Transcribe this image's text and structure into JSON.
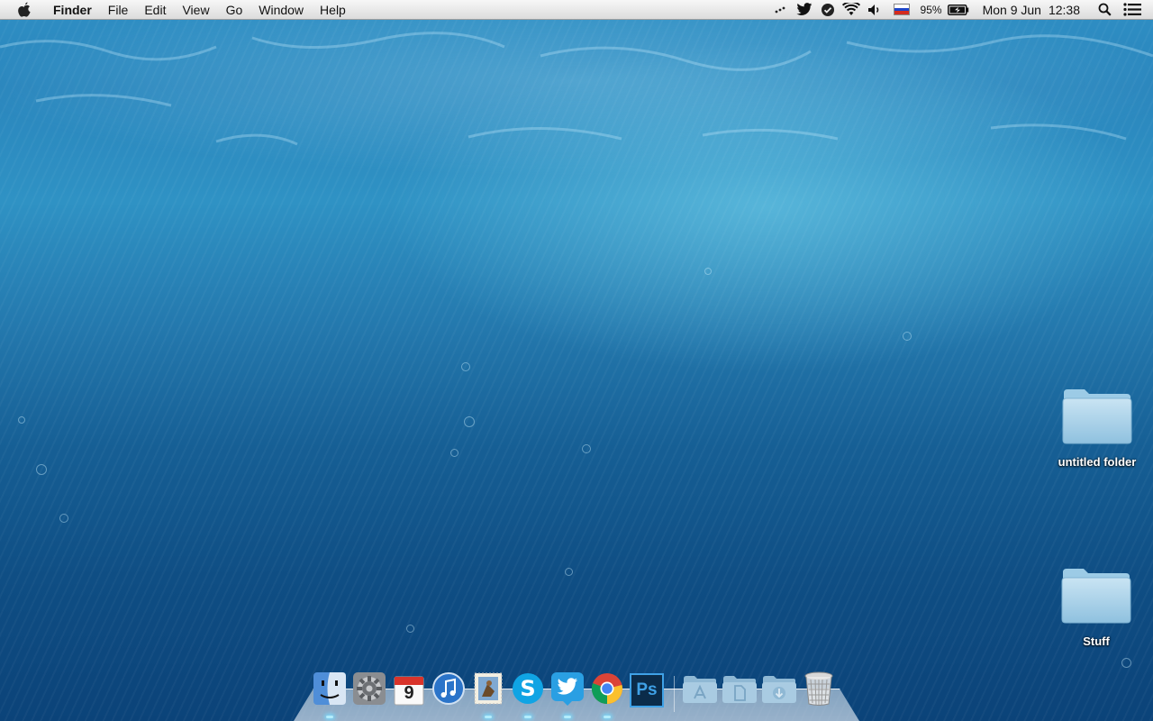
{
  "menubar": {
    "app_name": "Finder",
    "menus": [
      "File",
      "Edit",
      "View",
      "Go",
      "Window",
      "Help"
    ],
    "status": {
      "battery_percent": "95%",
      "date": "Mon 9 Jun",
      "time": "12:38"
    }
  },
  "desktop": {
    "items": [
      {
        "label": "untitled folder",
        "icon": "folder-icon"
      },
      {
        "label": "Stuff",
        "icon": "folder-icon"
      }
    ]
  },
  "dock": {
    "apps": [
      {
        "name": "Finder",
        "icon": "finder-icon",
        "running": true
      },
      {
        "name": "System Preferences",
        "icon": "gear-icon",
        "running": false
      },
      {
        "name": "Calendar",
        "icon": "calendar-icon",
        "running": false
      },
      {
        "name": "iTunes",
        "icon": "itunes-icon",
        "running": false
      },
      {
        "name": "Mail",
        "icon": "mail-stamp-icon",
        "running": true
      },
      {
        "name": "Skype",
        "icon": "skype-icon",
        "running": true
      },
      {
        "name": "Twitter",
        "icon": "twitter-icon",
        "running": true
      },
      {
        "name": "Chrome",
        "icon": "chrome-icon",
        "running": true
      },
      {
        "name": "Photoshop",
        "icon": "photoshop-icon",
        "running": false
      }
    ],
    "calendar_day": "9",
    "photoshop_label": "Ps",
    "stacks": [
      {
        "icon": "applications-folder-icon"
      },
      {
        "icon": "documents-folder-icon"
      },
      {
        "icon": "downloads-folder-icon"
      }
    ],
    "trash": {
      "icon": "trash-icon"
    }
  },
  "colors": {
    "menubar_top": "#f7f7f7",
    "desktop_deep": "#0b4379",
    "desktop_light": "#2f92c4",
    "running_indicator": "#b4f0ff"
  }
}
